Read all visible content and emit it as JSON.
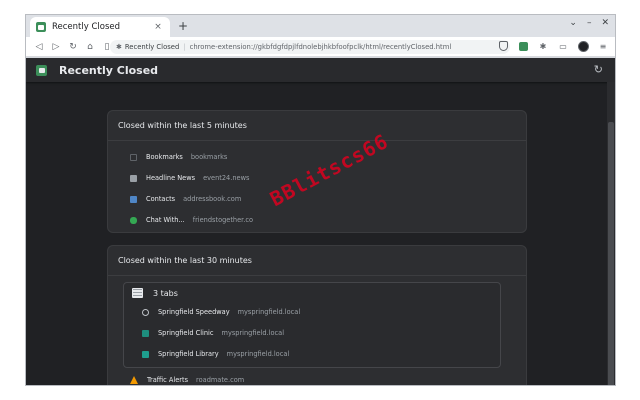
{
  "browser": {
    "tab_title": "Recently Closed",
    "tab_close": "×",
    "new_tab": "+",
    "omnibox_ext_icon": "✱",
    "omnibox_name": "Recently Closed",
    "omnibox_sep": "|",
    "omnibox_url": "chrome-extension://gkbfdgfdpjlfdnolebjhkbfoofpclk/html/recentlyClosed.html"
  },
  "app": {
    "title": "Recently Closed",
    "refresh_icon": "↻"
  },
  "sections": [
    {
      "title": "Closed within the last 5 minutes",
      "items": [
        {
          "title": "Bookmarks",
          "url": "bookmarks",
          "icon": "bookmark-icon",
          "color": "#3a3b3e"
        },
        {
          "title": "Headline News",
          "url": "event24.news",
          "icon": "news-icon",
          "color": "#9aa0a6"
        },
        {
          "title": "Contacts",
          "url": "addressbook.com",
          "icon": "contacts-icon",
          "color": "#4f86c6"
        },
        {
          "title": "Chat With...",
          "url": "friendstogether.co",
          "icon": "chat-icon",
          "color": "#34a853"
        }
      ]
    },
    {
      "title": "Closed within the last 30 minutes",
      "group": {
        "label": "3 tabs",
        "items": [
          {
            "title": "Springfield Speedway",
            "url": "myspringfield.local",
            "icon": "speedway-icon",
            "color": "#bdc1c6"
          },
          {
            "title": "Springfield Clinic",
            "url": "myspringfield.local",
            "icon": "clinic-icon",
            "color": "#1e8e7e"
          },
          {
            "title": "Springfield Library",
            "url": "myspringfield.local",
            "icon": "library-icon",
            "color": "#1e9e8e"
          }
        ]
      },
      "items": [
        {
          "title": "Traffic Alerts",
          "url": "roadmate.com",
          "icon": "traffic-cone-icon",
          "color": "#f29900"
        }
      ]
    }
  ],
  "watermark": "BBlitscs66",
  "colors": {
    "page_bg": "#202124",
    "card_bg": "#2d2e31",
    "accent": "#3c8f5a"
  }
}
